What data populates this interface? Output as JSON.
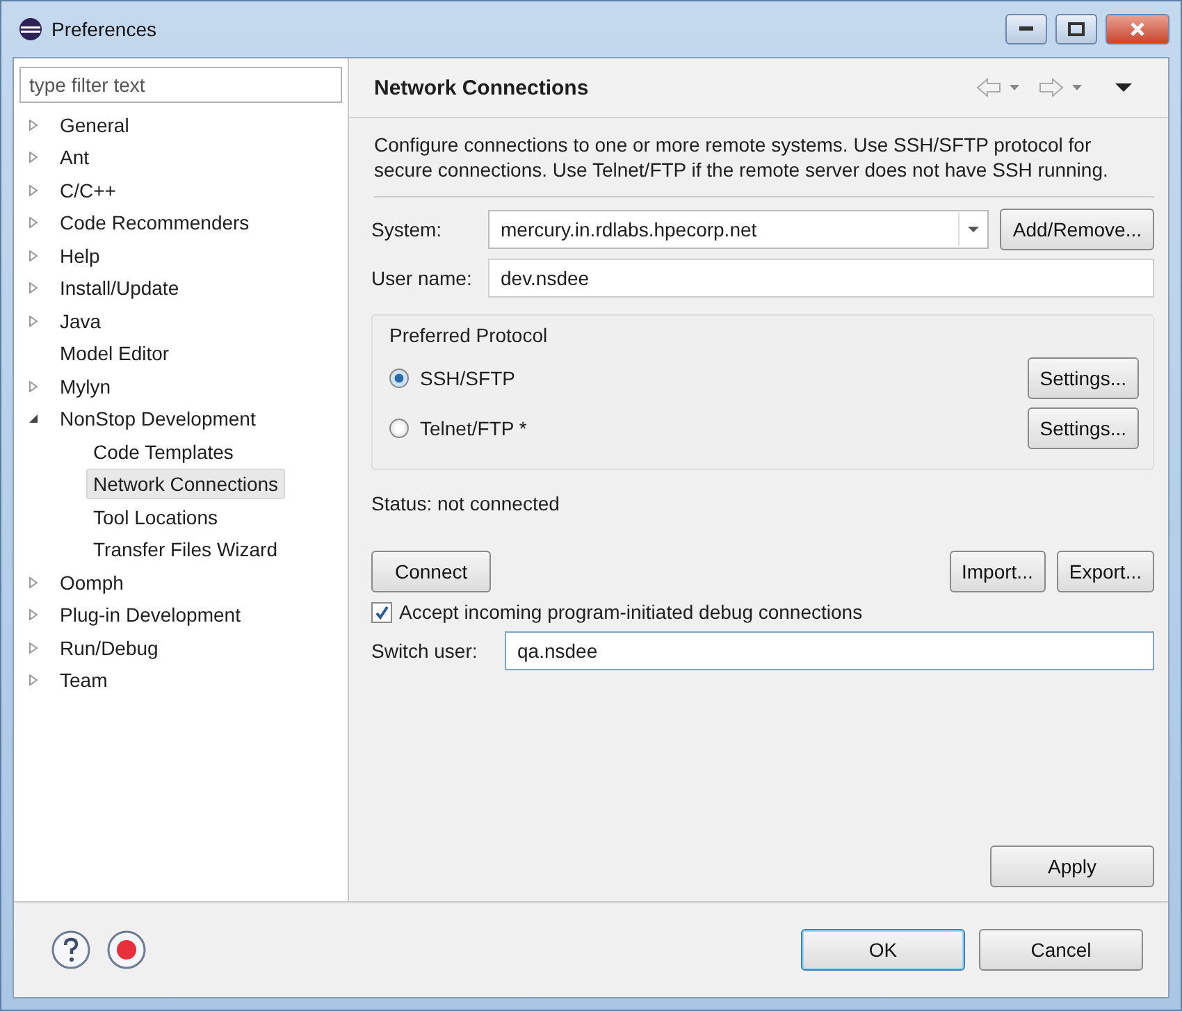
{
  "window": {
    "title": "Preferences"
  },
  "filter": {
    "placeholder": "type filter text"
  },
  "tree": [
    {
      "label": "General",
      "expandable": true,
      "expanded": false,
      "selected": false
    },
    {
      "label": "Ant",
      "expandable": true,
      "expanded": false,
      "selected": false
    },
    {
      "label": "C/C++",
      "expandable": true,
      "expanded": false,
      "selected": false
    },
    {
      "label": "Code Recommenders",
      "expandable": true,
      "expanded": false,
      "selected": false
    },
    {
      "label": "Help",
      "expandable": true,
      "expanded": false,
      "selected": false
    },
    {
      "label": "Install/Update",
      "expandable": true,
      "expanded": false,
      "selected": false
    },
    {
      "label": "Java",
      "expandable": true,
      "expanded": false,
      "selected": false
    },
    {
      "label": "Model Editor",
      "expandable": false,
      "selected": false
    },
    {
      "label": "Mylyn",
      "expandable": true,
      "expanded": false,
      "selected": false
    },
    {
      "label": "NonStop Development",
      "expandable": true,
      "expanded": true,
      "selected": false,
      "children": [
        {
          "label": "Code Templates",
          "expandable": false,
          "selected": false
        },
        {
          "label": "Network Connections",
          "expandable": false,
          "selected": true
        },
        {
          "label": "Tool Locations",
          "expandable": false,
          "selected": false
        },
        {
          "label": "Transfer Files Wizard",
          "expandable": false,
          "selected": false
        }
      ]
    },
    {
      "label": "Oomph",
      "expandable": true,
      "expanded": false,
      "selected": false
    },
    {
      "label": "Plug-in Development",
      "expandable": true,
      "expanded": false,
      "selected": false
    },
    {
      "label": "Run/Debug",
      "expandable": true,
      "expanded": false,
      "selected": false
    },
    {
      "label": "Team",
      "expandable": true,
      "expanded": false,
      "selected": false
    }
  ],
  "page": {
    "title": "Network Connections",
    "description": "Configure connections to one or more remote systems. Use SSH/SFTP protocol for secure connections. Use Telnet/FTP if the remote server does not have SSH running.",
    "system": {
      "label": "System:",
      "value": "mercury.in.rdlabs.hpecorp.net",
      "button": "Add/Remove..."
    },
    "user_name": {
      "label": "User name:",
      "value": "dev.nsdee"
    },
    "protocol": {
      "title": "Preferred Protocol",
      "options": [
        {
          "label": "SSH/SFTP",
          "selected": true,
          "button": "Settings..."
        },
        {
          "label": "Telnet/FTP *",
          "selected": false,
          "button": "Settings..."
        }
      ]
    },
    "status": "Status: not connected",
    "connect_button": "Connect",
    "import_button": "Import...",
    "export_button": "Export...",
    "accept_debug": {
      "label": "Accept incoming program-initiated debug connections",
      "checked": true
    },
    "switch_user": {
      "label": "Switch user:",
      "value": "qa.nsdee"
    },
    "apply_button": "Apply"
  },
  "buttons": [
    "OK",
    "Cancel"
  ]
}
